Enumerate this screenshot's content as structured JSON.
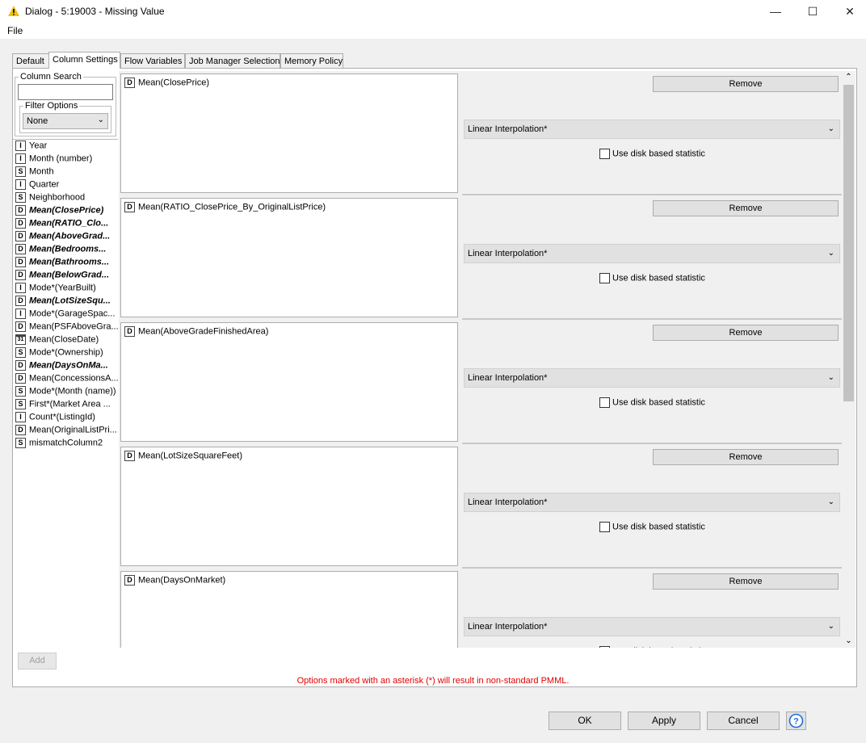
{
  "window": {
    "title": "Dialog - 5:19003 - Missing Value"
  },
  "menu": [
    "File"
  ],
  "tabs": [
    "Default",
    "Column Settings",
    "Flow Variables",
    "Job Manager Selection",
    "Memory Policy"
  ],
  "left_panel": {
    "search_label": "Column Search",
    "search_value": "",
    "filter_label": "Filter Options",
    "filter_value": "None"
  },
  "columns": [
    {
      "type": "I",
      "name": "Year",
      "bold": false
    },
    {
      "type": "I",
      "name": "Month (number)",
      "bold": false
    },
    {
      "type": "S",
      "name": "Month",
      "bold": false
    },
    {
      "type": "I",
      "name": "Quarter",
      "bold": false
    },
    {
      "type": "S",
      "name": "Neighborhood",
      "bold": false
    },
    {
      "type": "D",
      "name": "Mean(ClosePrice)",
      "bold": true
    },
    {
      "type": "D",
      "name": "Mean(RATIO_Clo...",
      "bold": true
    },
    {
      "type": "D",
      "name": "Mean(AboveGrad...",
      "bold": true
    },
    {
      "type": "D",
      "name": "Mean(Bedrooms...",
      "bold": true
    },
    {
      "type": "D",
      "name": "Mean(Bathrooms...",
      "bold": true
    },
    {
      "type": "D",
      "name": "Mean(BelowGrad...",
      "bold": true
    },
    {
      "type": "I",
      "name": "Mode*(YearBuilt)",
      "bold": false
    },
    {
      "type": "D",
      "name": "Mean(LotSizeSqu...",
      "bold": true
    },
    {
      "type": "I",
      "name": "Mode*(GarageSpac...",
      "bold": false
    },
    {
      "type": "D",
      "name": "Mean(PSFAboveGra...",
      "bold": false
    },
    {
      "type": "31",
      "name": "Mean(CloseDate)",
      "bold": false
    },
    {
      "type": "S",
      "name": "Mode*(Ownership)",
      "bold": false
    },
    {
      "type": "D",
      "name": "Mean(DaysOnMa...",
      "bold": true
    },
    {
      "type": "D",
      "name": "Mean(ConcessionsA...",
      "bold": false
    },
    {
      "type": "S",
      "name": "Mode*(Month (name))",
      "bold": false
    },
    {
      "type": "S",
      "name": "First*(Market Area ...",
      "bold": false
    },
    {
      "type": "I",
      "name": "Count*(ListingId)",
      "bold": false
    },
    {
      "type": "D",
      "name": "Mean(OriginalListPri...",
      "bold": false
    },
    {
      "type": "S",
      "name": "mismatchColumn2",
      "bold": false
    }
  ],
  "settings_blocks": [
    {
      "type": "D",
      "column": "Mean(ClosePrice)",
      "remove_label": "Remove",
      "method": "Linear Interpolation*",
      "disk_label": "Use disk based statistic"
    },
    {
      "type": "D",
      "column": "Mean(RATIO_ClosePrice_By_OriginalListPrice)",
      "remove_label": "Remove",
      "method": "Linear Interpolation*",
      "disk_label": "Use disk based statistic"
    },
    {
      "type": "D",
      "column": "Mean(AboveGradeFinishedArea)",
      "remove_label": "Remove",
      "method": "Linear Interpolation*",
      "disk_label": "Use disk based statistic"
    },
    {
      "type": "D",
      "column": "Mean(LotSizeSquareFeet)",
      "remove_label": "Remove",
      "method": "Linear Interpolation*",
      "disk_label": "Use disk based statistic"
    },
    {
      "type": "D",
      "column": "Mean(DaysOnMarket)",
      "remove_label": "Remove",
      "method": "Linear Interpolation*",
      "disk_label": "Use disk based statistic"
    }
  ],
  "buttons": {
    "add": "Add",
    "ok": "OK",
    "apply": "Apply",
    "cancel": "Cancel"
  },
  "note": "Options marked with an asterisk (*) will result in non-standard PMML.",
  "colors": {
    "note": "#e00000",
    "warning_icon": "#f2c200"
  }
}
